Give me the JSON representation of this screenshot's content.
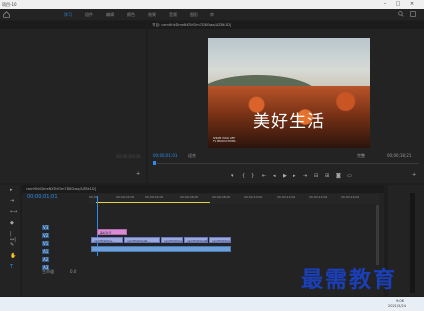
{
  "window": {
    "title": "项目-10"
  },
  "menu": {
    "items": [
      "学习",
      "组件",
      "编辑",
      "颜色",
      "效果",
      "音频",
      "图形",
      "库"
    ],
    "active_index": 0
  },
  "program": {
    "title": "节目: camHhkDmeNXTcfGm7D8Gwa/AZBk1D]",
    "caption": "美好生活",
    "brand": [
      "SHUIM YOUR LIFE",
      "TV PRODUCTIONS"
    ],
    "timecode_left": "00;00;01;01",
    "fit_label": "适合",
    "full_label": "完整",
    "timecode_right": "00;00;18;21"
  },
  "source": {
    "timecode": "00;00;00;00"
  },
  "timeline": {
    "title": "camHhkDmeNXTcfGm7D8Gwa/AZBk1D]",
    "timecode": "00;00;01;01",
    "ruler": [
      "00;00",
      "00;00;02;00",
      "00;00;04;00",
      "00;00;06;00",
      "00;00;08;00",
      "00;00;10;00",
      "00;00;12;00",
      "00;00;14;00",
      "00;00;16;00"
    ],
    "tracks": [
      "V3",
      "V2",
      "V1",
      "A1",
      "A2",
      "A3"
    ],
    "master_label": "主声道",
    "master_value": "0.0",
    "title_clip": "美好生活",
    "video_clips": [
      "camHhkDme…",
      "camHhkDmeN…",
      "camHhkDmeN…",
      "camHhkDmeN…",
      "camHhkDme…"
    ]
  },
  "taskbar": {
    "time": "9:06",
    "date": "2021/5/24"
  },
  "watermark": "最需教育"
}
